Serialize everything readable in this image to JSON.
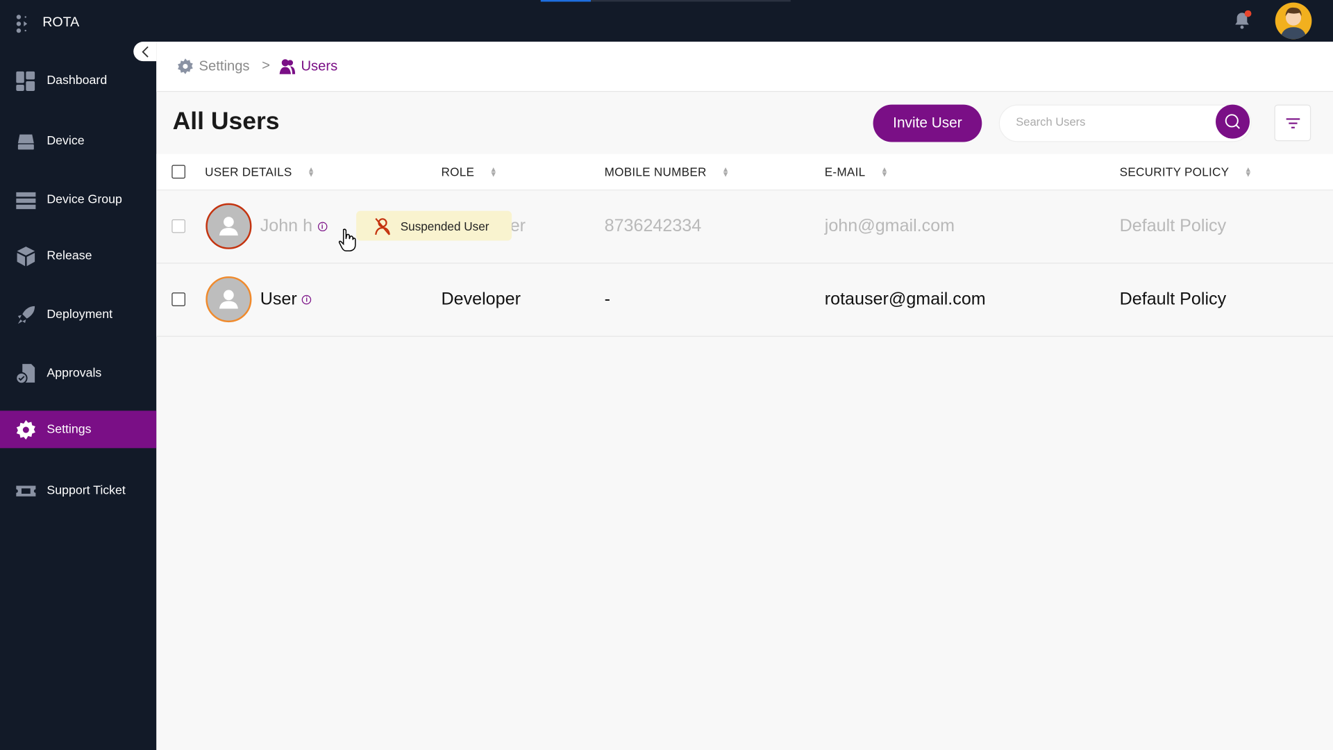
{
  "app": {
    "brand": "ROTA",
    "notification_badge": true
  },
  "sidebar": {
    "items": [
      {
        "label": "Dashboard",
        "icon": "dashboard-icon"
      },
      {
        "label": "Device",
        "icon": "device-icon"
      },
      {
        "label": "Device Group",
        "icon": "device-group-icon"
      },
      {
        "label": "Release",
        "icon": "box-icon"
      },
      {
        "label": "Deployment",
        "icon": "rocket-icon"
      },
      {
        "label": "Approvals",
        "icon": "approvals-icon"
      },
      {
        "label": "Settings",
        "icon": "gear-icon",
        "active": true
      },
      {
        "label": "Support Ticket",
        "icon": "ticket-icon"
      }
    ]
  },
  "breadcrumb": {
    "parent": "Settings",
    "separator": ">",
    "current": "Users"
  },
  "page": {
    "title": "All Users",
    "invite_label": "Invite User",
    "search_placeholder": "Search Users"
  },
  "table": {
    "columns": [
      "USER DETAILS",
      "ROLE",
      "MOBILE NUMBER",
      "E-MAIL",
      "SECURITY POLICY"
    ],
    "rows": [
      {
        "name": "John h",
        "role": "er",
        "mobile": "8736242334",
        "email": "john@gmail.com",
        "policy": "Default Policy",
        "status": "suspended"
      },
      {
        "name": "User",
        "role": "Developer",
        "mobile": "-",
        "email": "rotauser@gmail.com",
        "policy": "Default Policy",
        "status": "active"
      }
    ]
  },
  "tooltip": {
    "text": "Suspended User"
  },
  "colors": {
    "accent": "#7a0f86",
    "sidebar": "#121a28",
    "suspended_ring": "#c4330f",
    "active_ring": "#f08a2c",
    "tooltip_bg": "#f9f3cf"
  }
}
